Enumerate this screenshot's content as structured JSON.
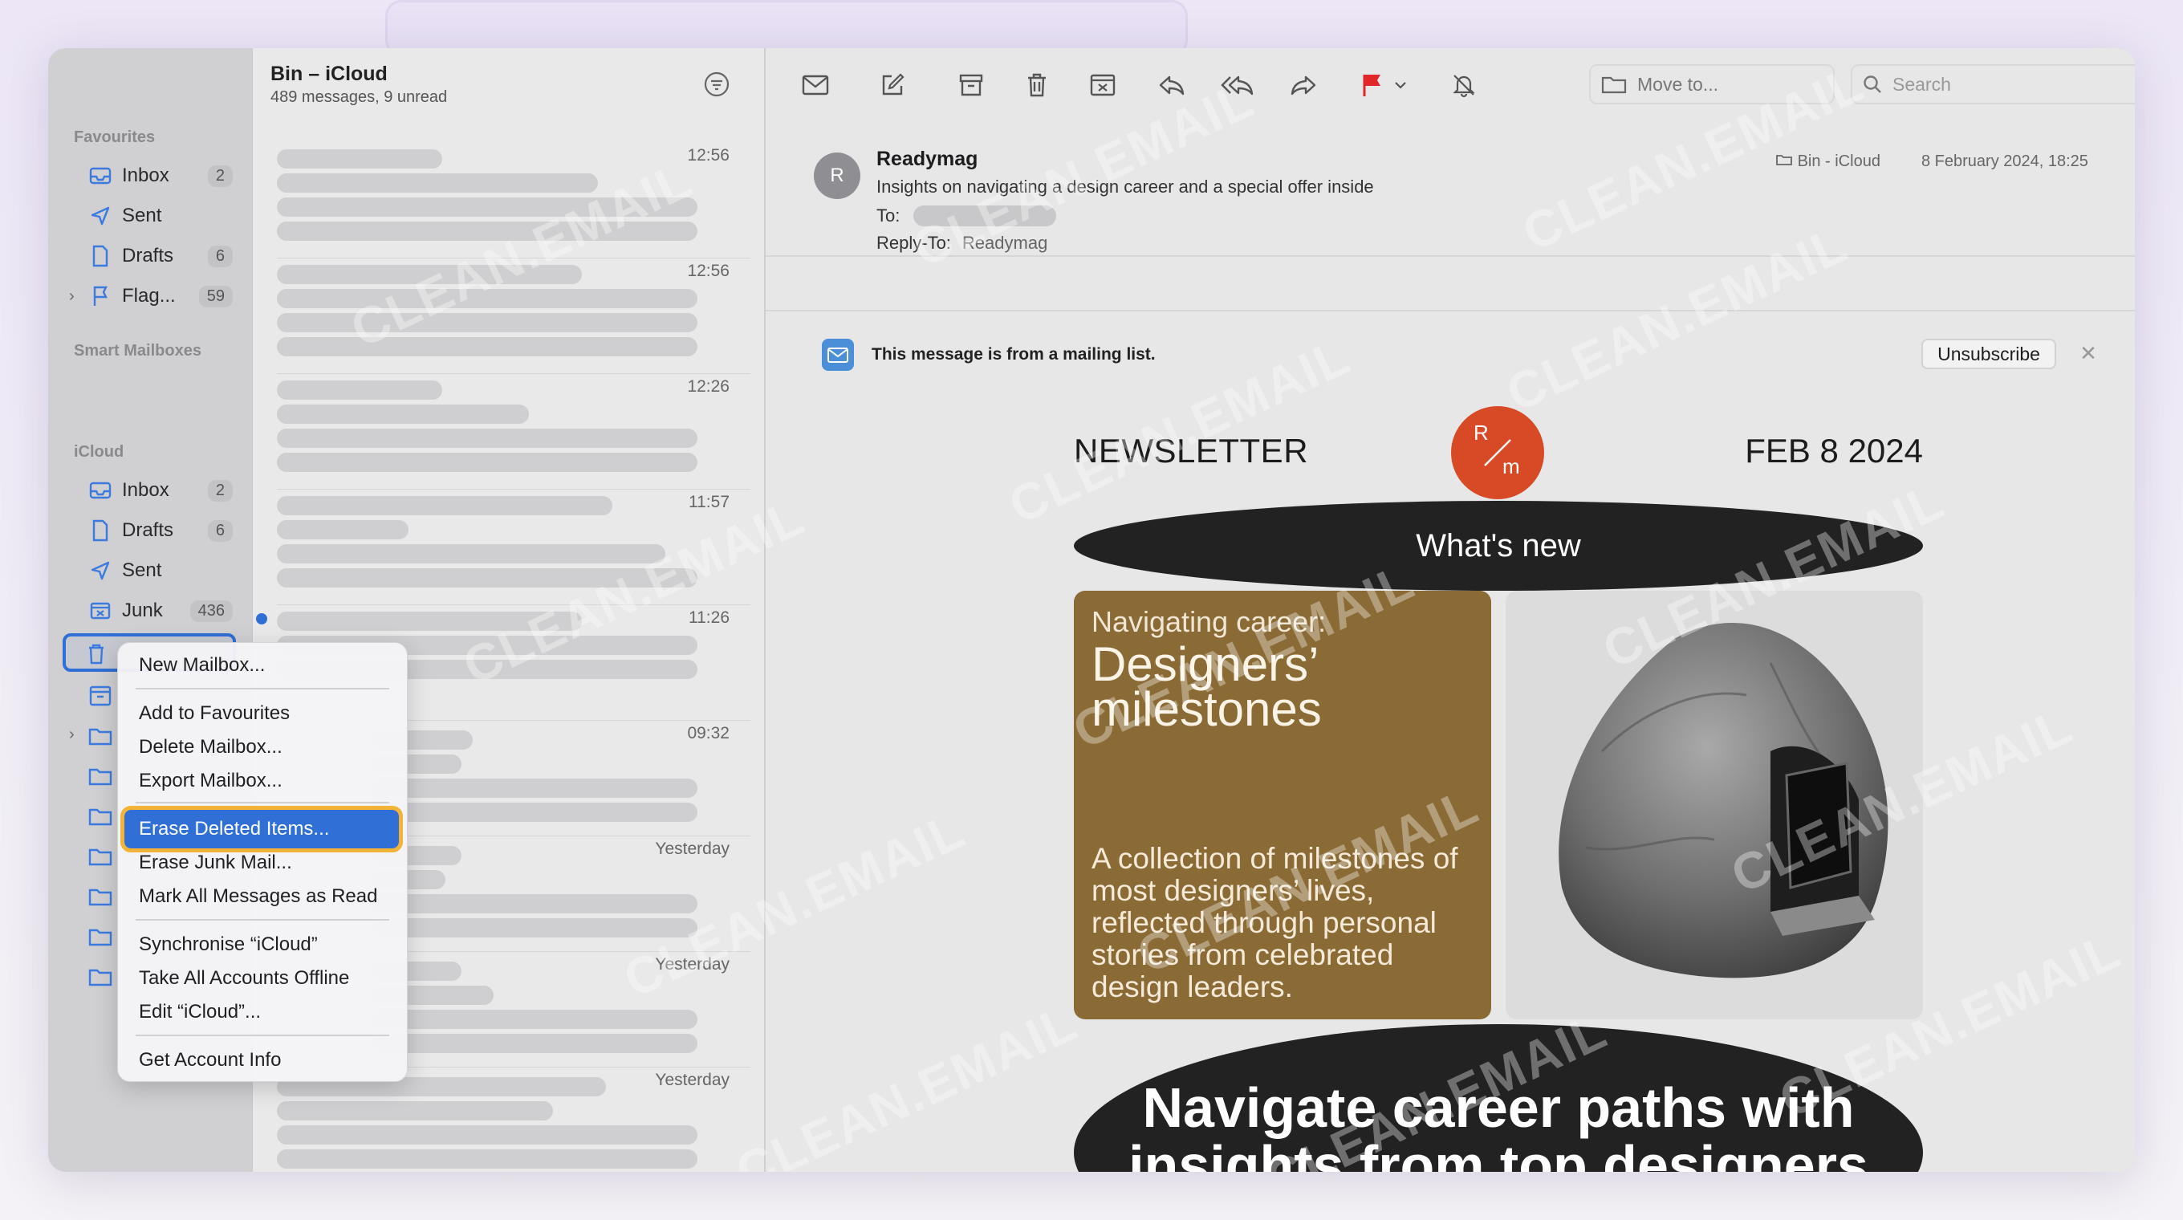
{
  "sidebar": {
    "favourites_label": "Favourites",
    "smart_mailboxes_label": "Smart Mailboxes",
    "icloud_label": "iCloud",
    "favourites": [
      {
        "label": "Inbox",
        "count": "2",
        "icon": "inbox-icon"
      },
      {
        "label": "Sent",
        "count": "",
        "icon": "sent-icon"
      },
      {
        "label": "Drafts",
        "count": "6",
        "icon": "drafts-icon"
      },
      {
        "label": "Flag...",
        "count": "59",
        "icon": "flag-icon"
      }
    ],
    "icloud": [
      {
        "label": "Inbox",
        "count": "2",
        "icon": "inbox-icon"
      },
      {
        "label": "Drafts",
        "count": "6",
        "icon": "drafts-icon"
      },
      {
        "label": "Sent",
        "count": "",
        "icon": "sent-icon"
      },
      {
        "label": "Junk",
        "count": "436",
        "icon": "junk-icon"
      }
    ]
  },
  "message_list": {
    "title": "Bin – iCloud",
    "subtitle": "489 messages, 9 unread",
    "times": [
      "12:56",
      "12:56",
      "12:26",
      "11:57",
      "11:26",
      "09:32",
      "Yesterday",
      "Yesterday",
      "Yesterday"
    ]
  },
  "toolbar": {
    "move_to": "Move to...",
    "search_placeholder": "Search"
  },
  "email": {
    "avatar_letter": "R",
    "sender": "Readymag",
    "subject": "Insights on navigating a design career and a special offer inside",
    "to_label": "To:",
    "reply_to_label": "Reply-To:",
    "reply_to_value": "Readymag",
    "mailbox": "Bin - iCloud",
    "date": "8 February 2024, 18:25",
    "mailing_list_notice": "This message is from a mailing list.",
    "unsubscribe": "Unsubscribe"
  },
  "newsletter": {
    "left_title": "NEWSLETTER",
    "right_date": "FEB 8 2024",
    "logo_top": "R",
    "logo_bottom": "m",
    "whats_new": "What's new",
    "card_kicker": "Navigating career:",
    "card_title": "Designers’ milestones",
    "card_body": "A collection of milestones of most designers’ lives, reflected through personal stories from celebrated design leaders.",
    "banner": "Navigate career paths with insights from top designers"
  },
  "context_menu": {
    "items": [
      "New Mailbox...",
      "Add to Favourites",
      "Delete Mailbox...",
      "Export Mailbox...",
      "Erase Deleted Items...",
      "Erase Junk Mail...",
      "Mark All Messages as Read",
      "Synchronise “iCloud”",
      "Take All Accounts Offline",
      "Edit “iCloud”...",
      "Get Account Info"
    ],
    "highlighted_index": 4
  },
  "watermark": "CLEAN.EMAIL",
  "colors": {
    "accent": "#2f6fd6",
    "highlight_outline": "#f3b336",
    "flag": "#e0262a",
    "logo": "#d84a26"
  }
}
